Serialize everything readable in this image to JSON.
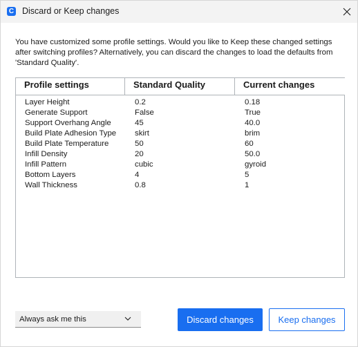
{
  "window": {
    "title": "Discard or Keep changes",
    "app_icon_letter": "C",
    "accent_color": "#196ef0"
  },
  "message": "You have customized some profile settings. Would you like to Keep these changed settings after switching profiles? Alternatively, you can discard the changes to load the defaults from 'Standard Quality'.",
  "table": {
    "headers": [
      "Profile settings",
      "Standard Quality",
      "Current changes"
    ],
    "rows": [
      [
        "Layer Height",
        "0.2",
        "0.18"
      ],
      [
        "Generate Support",
        "False",
        "True"
      ],
      [
        "Support Overhang Angle",
        "45",
        "40.0"
      ],
      [
        "Build Plate Adhesion Type",
        "skirt",
        "brim"
      ],
      [
        "Build Plate Temperature",
        "50",
        "60"
      ],
      [
        "Infill Density",
        "20",
        "50.0"
      ],
      [
        "Infill Pattern",
        "cubic",
        "gyroid"
      ],
      [
        "Bottom Layers",
        "4",
        "5"
      ],
      [
        "Wall Thickness",
        "0.8",
        "1"
      ]
    ]
  },
  "footer": {
    "dropdown_value": "Always ask me this",
    "discard_label": "Discard changes",
    "keep_label": "Keep changes"
  },
  "icons": {
    "app": "cura-app-icon",
    "close": "close-icon",
    "dropdown": "chevron-down-icon"
  }
}
